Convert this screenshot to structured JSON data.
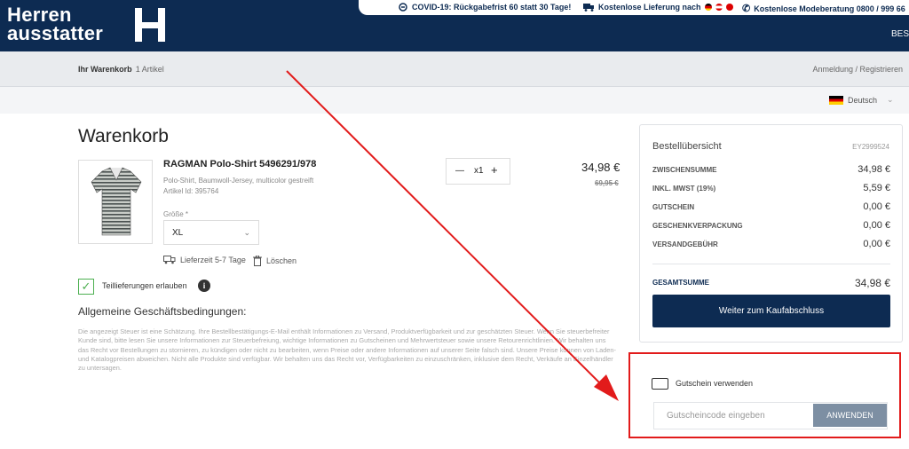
{
  "brand": {
    "name_line1": "Herren",
    "name_line2": "ausstatter",
    "logo_mark": "H"
  },
  "topbar": {
    "covid": "COVID-19: Rückgabefrist 60 statt 30 Tage!",
    "shipping": "Kostenlose Lieferung nach",
    "advice": "Kostenlose Modeberatung 0800 / 999 66"
  },
  "header": {
    "nav_right": "BES"
  },
  "breadcrumb": {
    "title": "Ihr Warenkorb",
    "count": "1 Artikel"
  },
  "account": {
    "login": "Anmeldung / Registrieren"
  },
  "language": {
    "selected": "Deutsch"
  },
  "cart": {
    "title": "Warenkorb",
    "item": {
      "name": "RAGMAN Polo-Shirt 5496291/978",
      "description": "Polo-Shirt, Baumwoll-Jersey, multicolor gestreift",
      "article_id": "Artikel Id: 395764",
      "size_label": "Größe *",
      "size_value": "XL",
      "quantity": "x1",
      "price": "34,98 €",
      "old_price": "69,95 €",
      "delivery": "Lieferzeit 5-7 Tage",
      "delete": "Löschen"
    },
    "partial_delivery": "Teillieferungen erlauben",
    "agb_title": "Allgemeine Geschäftsbedingungen:",
    "agb_text": "Die angezeigt Steuer ist eine Schätzung. Ihre Bestellbestätigungs-E-Mail enthält Informationen zu Versand, Produktverfügbarkeit und zur geschätzten Steuer. Wenn Sie steuerbefreiter Kunde sind, bitte lesen Sie unsere Informationen zur Steuerbefreiung, wichtige Informationen zu Gutscheinen und Mehrwertsteuer sowie unsere Retourenrichtlinien. Wir behalten uns das Recht vor Bestellungen zu stornieren, zu kündigen oder nicht zu bearbeiten, wenn Preise oder andere Informationen auf unserer Seite falsch sind. Unsere Preise können von Laden- und Katalogpreisen abweichen. Nicht alle Produkte sind verfügbar. Wir behalten uns das Recht vor, Verfügbarkeiten zu einzuschränken, inklusive dem Recht, Verkäufe an Einzelhändler zu untersagen."
  },
  "summary": {
    "title": "Bestellübersicht",
    "order_id": "EY2999524",
    "rows": [
      {
        "label": "ZWISCHENSUMME",
        "value": "34,98 €"
      },
      {
        "label": "INKL. MWST (19%)",
        "value": "5,59 €"
      },
      {
        "label": "GUTSCHEIN",
        "value": "0,00 €"
      },
      {
        "label": "GESCHENKVERPACKUNG",
        "value": "0,00 €"
      },
      {
        "label": "VERSANDGEBÜHR",
        "value": "0,00 €"
      }
    ],
    "total_label": "GESAMTSUMME",
    "total_value": "34,98 €",
    "checkout_button": "Weiter zum Kaufabschluss"
  },
  "voucher": {
    "title": "Gutschein verwenden",
    "placeholder": "Gutscheincode eingeben",
    "apply_button": "ANWENDEN"
  },
  "colors": {
    "navy": "#0d2b52",
    "annotation_red": "#e21b1b",
    "apply_button": "#7d8fa3"
  }
}
